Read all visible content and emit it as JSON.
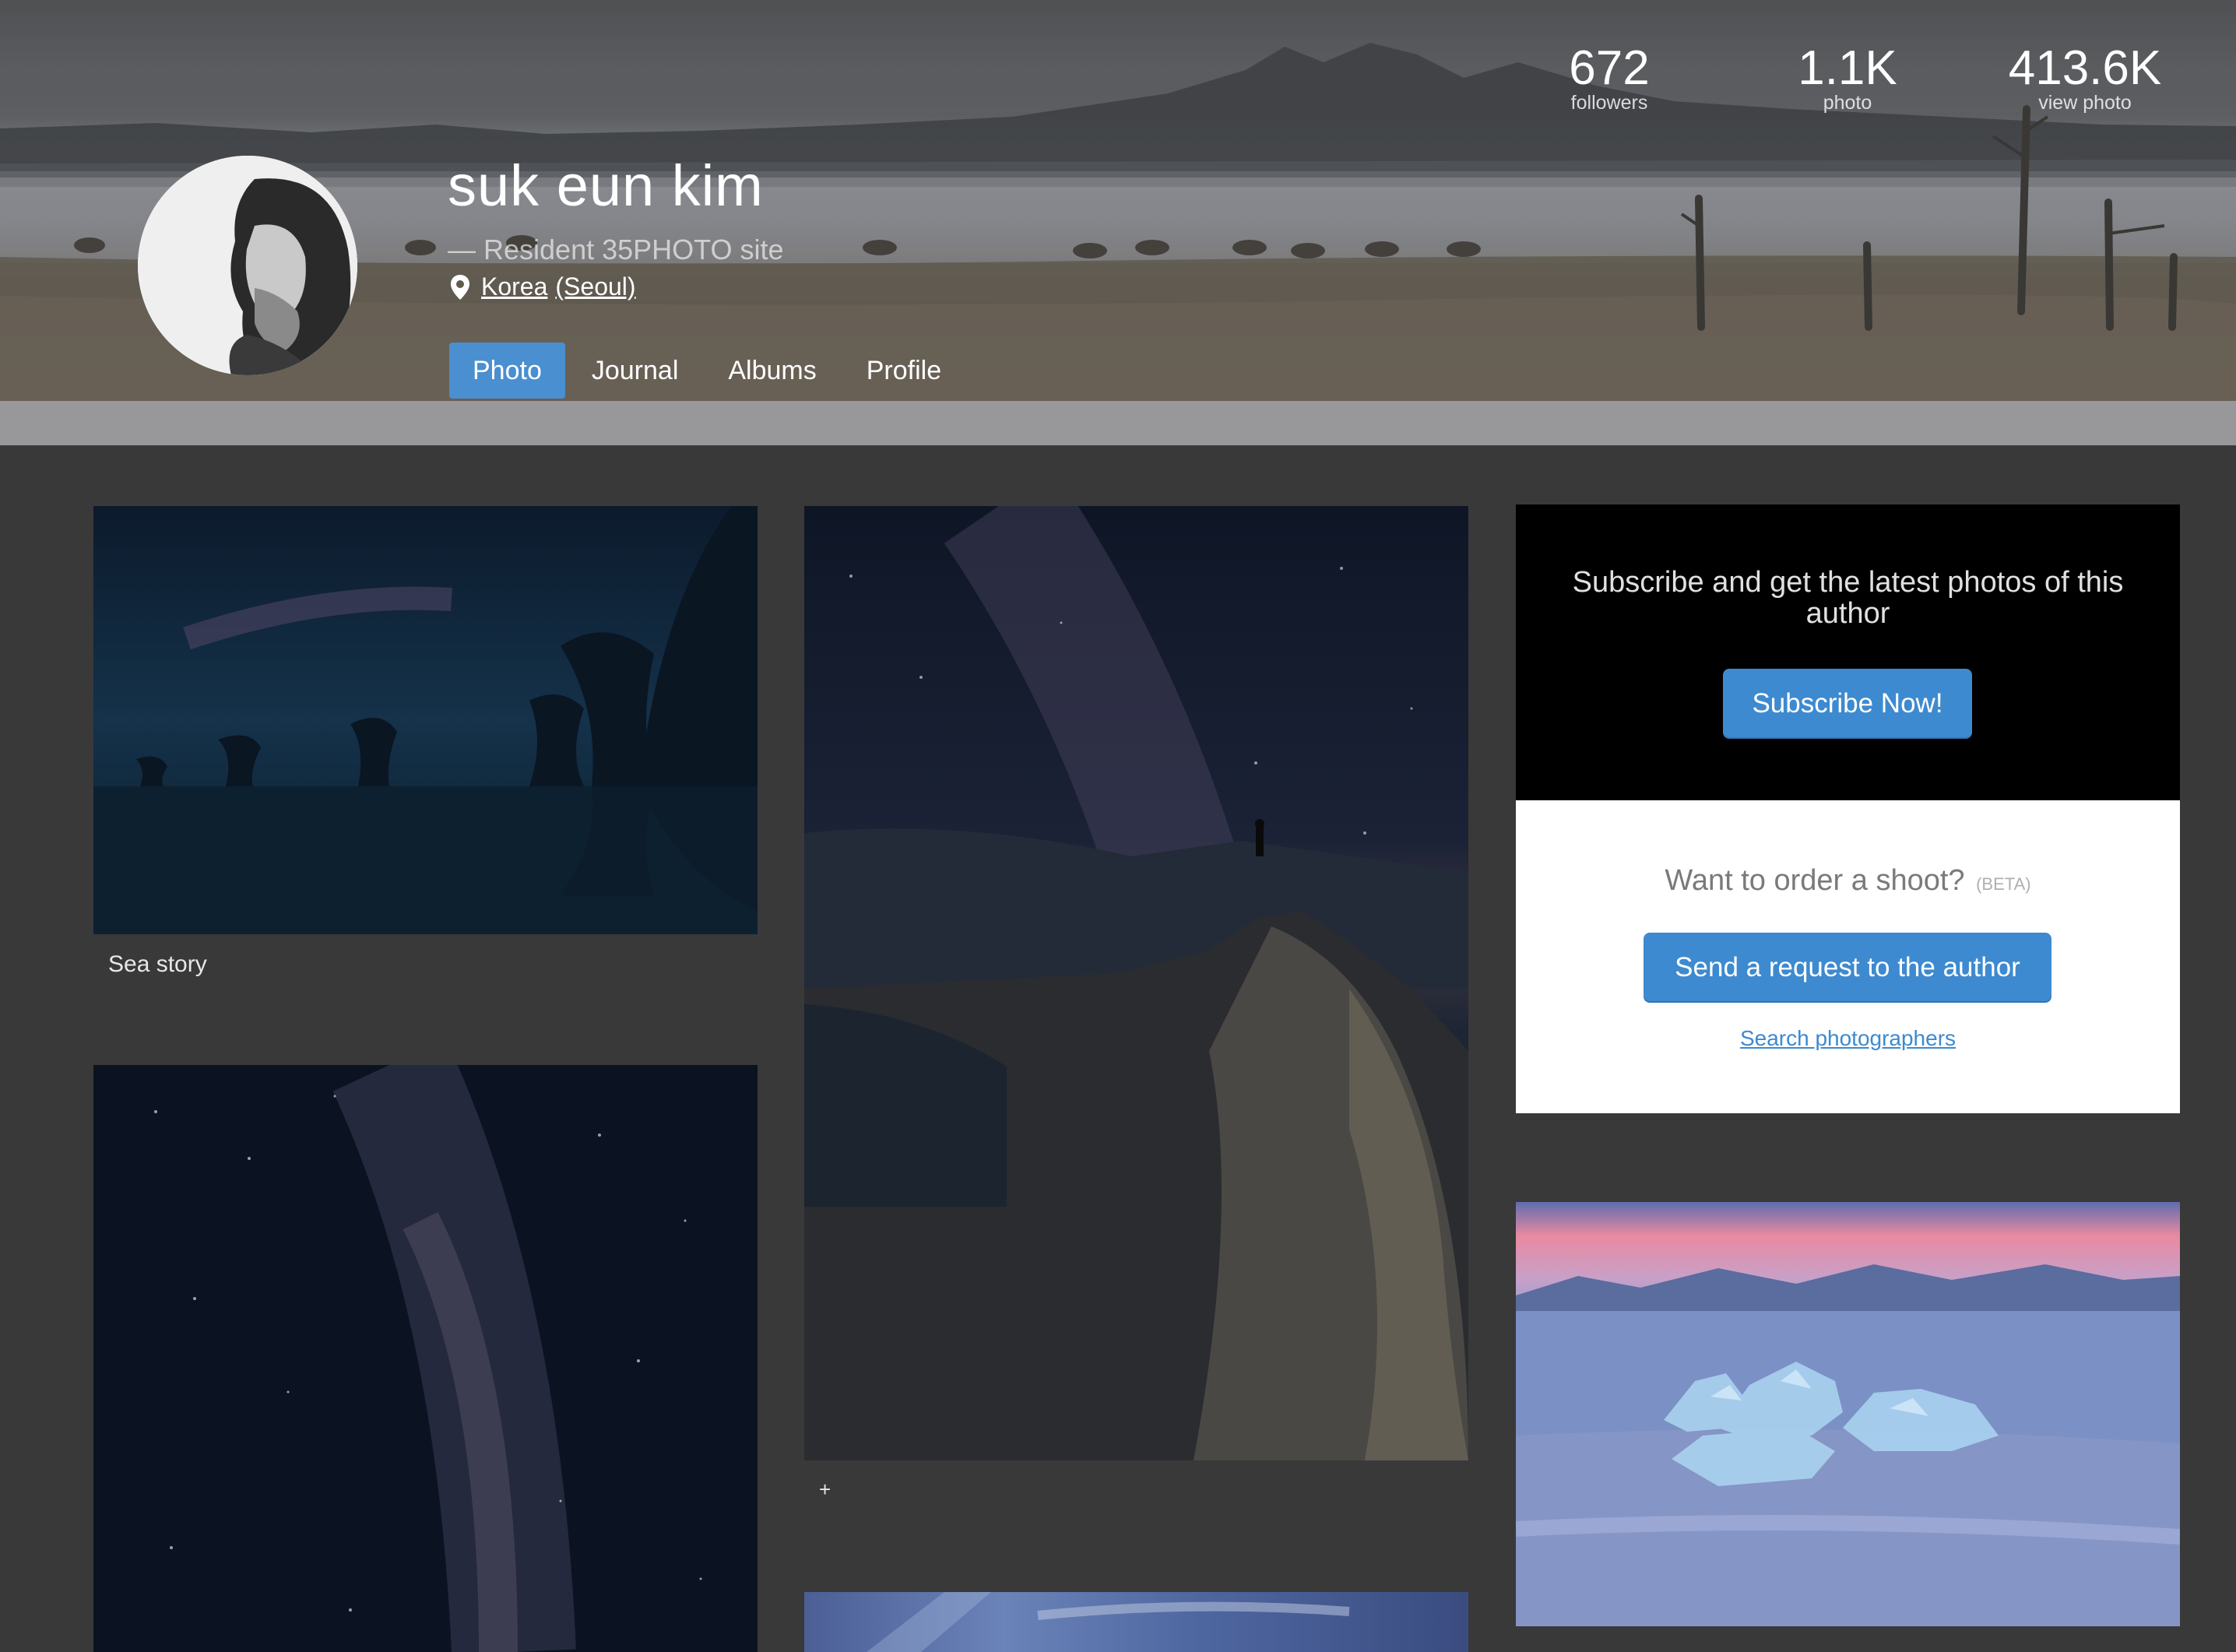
{
  "profile": {
    "name": "suk eun kim",
    "tagline": "— Resident 35PHOTO site",
    "location_country": "Korea",
    "location_city": "(Seoul)"
  },
  "stats": {
    "followers": {
      "value": "672",
      "label": "followers"
    },
    "photos": {
      "value": "1.1K",
      "label": "photo"
    },
    "views": {
      "value": "413.6K",
      "label": "view photo"
    }
  },
  "nav": {
    "tabs": [
      {
        "label": "Photo",
        "active": true
      },
      {
        "label": "Journal",
        "active": false
      },
      {
        "label": "Albums",
        "active": false
      },
      {
        "label": "Profile",
        "active": false
      }
    ]
  },
  "photos": {
    "sea_story": {
      "caption": "Sea story"
    },
    "mountain_night": {
      "caption": "+"
    }
  },
  "subscribe": {
    "text": "Subscribe and get the latest photos of this author",
    "button": "Subscribe Now!"
  },
  "order": {
    "question": "Want to order a shoot?",
    "beta": "(BETA)",
    "button": "Send a request to the author",
    "search_link": "Search photographers"
  },
  "colors": {
    "accent": "#4a8fd0",
    "page_background": "#393939",
    "link": "#3d8ad0"
  },
  "icons": {
    "location": "map-pin-icon"
  }
}
